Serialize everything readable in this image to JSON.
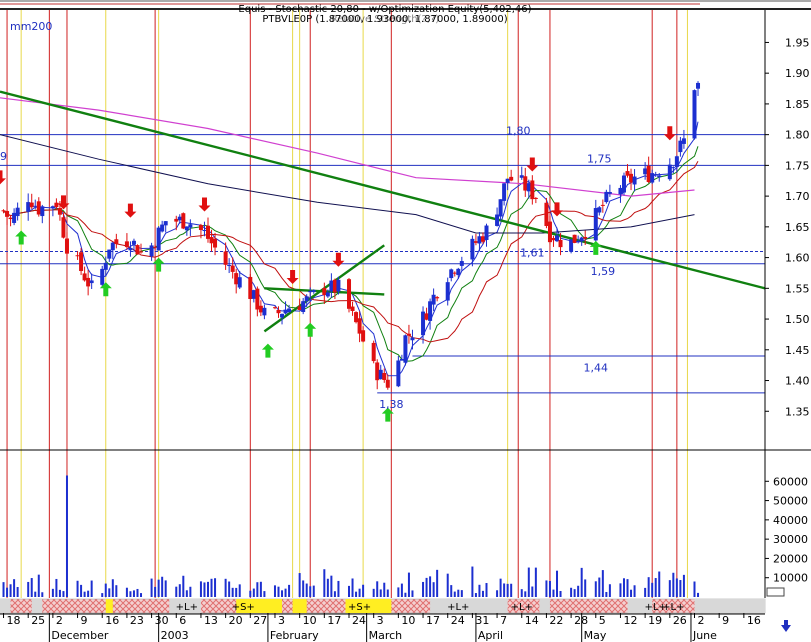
{
  "header": {
    "line1": "Equis - Stochastic 20,80 - w/Optimization Equity(5,402,46)",
    "line2": "PTBVLE0P (1.87000, 1.93000, 1.87000, 1.89000)",
    "overlay": "Relative Strength(?,?)"
  },
  "legend_mm": "mm200",
  "left_tag": "9",
  "price_labels": [
    {
      "text": "1,80",
      "price": 1.8,
      "date": "2003-04-13"
    },
    {
      "text": "1,75",
      "price": 1.755,
      "date": "2003-05-06"
    },
    {
      "text": "1,61",
      "price": 1.602,
      "date": "2003-04-17"
    },
    {
      "text": "1,59",
      "price": 1.572,
      "date": "2003-05-07"
    },
    {
      "text": "1,44",
      "price": 1.415,
      "date": "2003-05-05"
    },
    {
      "text": "1,38",
      "price": 1.355,
      "date": "2003-03-08"
    }
  ],
  "bar_labels": [
    {
      "text": "+L+",
      "date": "2003-01-09"
    },
    {
      "text": "+S+",
      "date": "2003-01-25"
    },
    {
      "text": "+S+",
      "date": "2003-02-27"
    },
    {
      "text": "+L+",
      "date": "2003-03-27"
    },
    {
      "text": "+L+",
      "date": "2003-04-14"
    },
    {
      "text": "+L+",
      "date": "2003-05-22"
    },
    {
      "text": "+L+",
      "date": "2003-05-27"
    }
  ],
  "chart_data": {
    "type": "candlestick",
    "title": "",
    "x_range": [
      "2002-11-17",
      "2003-06-22"
    ],
    "price_axis": {
      "range": [
        1.3,
        1.98
      ],
      "ticks": [
        1.35,
        1.4,
        1.45,
        1.5,
        1.55,
        1.6,
        1.65,
        1.7,
        1.75,
        1.8,
        1.85,
        1.9,
        1.95
      ]
    },
    "volume_axis": {
      "range": [
        0,
        70000
      ],
      "ticks": [
        10000,
        20000,
        30000,
        40000,
        50000,
        60000
      ]
    },
    "x_day_ticks": [
      "18",
      "25",
      "2",
      "9",
      "16",
      "23",
      "30",
      "6",
      "13",
      "20",
      "27",
      "3",
      "10",
      "17",
      "24",
      "3",
      "10",
      "17",
      "24",
      "31",
      "7",
      "14",
      "22",
      "28",
      "5",
      "12",
      "19",
      "26",
      "2",
      "9",
      "16"
    ],
    "x_month_labels": [
      {
        "text": "December",
        "date": "2002-12-01"
      },
      {
        "text": "2003",
        "date": "2003-01-01"
      },
      {
        "text": "February",
        "date": "2003-02-01"
      },
      {
        "text": "March",
        "date": "2003-03-01"
      },
      {
        "text": "April",
        "date": "2003-04-01"
      },
      {
        "text": "May",
        "date": "2003-05-01"
      },
      {
        "text": "June",
        "date": "2003-06-01"
      }
    ],
    "price_anchors": [
      [
        "2002-11-15",
        1.7
      ],
      [
        "2002-11-20",
        1.66
      ],
      [
        "2002-11-25",
        1.7
      ],
      [
        "2002-11-28",
        1.68
      ],
      [
        "2002-12-03",
        1.69
      ],
      [
        "2002-12-06",
        1.62
      ],
      [
        "2002-12-11",
        1.57
      ],
      [
        "2002-12-14",
        1.54
      ],
      [
        "2002-12-18",
        1.62
      ],
      [
        "2002-12-24",
        1.63
      ],
      [
        "2002-12-28",
        1.6
      ],
      [
        "2003-01-03",
        1.66
      ],
      [
        "2003-01-09",
        1.66
      ],
      [
        "2003-01-14",
        1.64
      ],
      [
        "2003-01-20",
        1.59
      ],
      [
        "2003-01-26",
        1.55
      ],
      [
        "2003-02-01",
        1.5
      ],
      [
        "2003-02-07",
        1.52
      ],
      [
        "2003-02-12",
        1.53
      ],
      [
        "2003-02-17",
        1.55
      ],
      [
        "2003-02-21",
        1.55
      ],
      [
        "2003-02-27",
        1.48
      ],
      [
        "2003-03-03",
        1.42
      ],
      [
        "2003-03-08",
        1.39
      ],
      [
        "2003-03-12",
        1.47
      ],
      [
        "2003-03-16",
        1.49
      ],
      [
        "2003-03-22",
        1.56
      ],
      [
        "2003-03-28",
        1.6
      ],
      [
        "2003-04-05",
        1.65
      ],
      [
        "2003-04-10",
        1.73
      ],
      [
        "2003-04-14",
        1.72
      ],
      [
        "2003-04-18",
        1.7
      ],
      [
        "2003-04-22",
        1.64
      ],
      [
        "2003-04-27",
        1.62
      ],
      [
        "2003-05-03",
        1.65
      ],
      [
        "2003-05-10",
        1.71
      ],
      [
        "2003-05-16",
        1.73
      ],
      [
        "2003-05-22",
        1.74
      ],
      [
        "2003-05-27",
        1.76
      ],
      [
        "2003-05-30",
        1.79
      ],
      [
        "2003-06-02",
        1.88
      ]
    ],
    "indicators": {
      "mm200": [
        [
          "2002-11-17",
          1.86
        ],
        [
          "2002-12-15",
          1.84
        ],
        [
          "2003-01-15",
          1.81
        ],
        [
          "2003-02-15",
          1.77
        ],
        [
          "2003-03-15",
          1.73
        ],
        [
          "2003-04-15",
          1.72
        ],
        [
          "2003-05-15",
          1.7
        ],
        [
          "2003-06-02",
          1.71
        ]
      ],
      "long_ma": [
        [
          "2002-11-17",
          1.8
        ],
        [
          "2002-12-15",
          1.76
        ],
        [
          "2003-01-15",
          1.72
        ],
        [
          "2003-02-15",
          1.69
        ],
        [
          "2003-03-15",
          1.67
        ],
        [
          "2003-04-01",
          1.64
        ],
        [
          "2003-04-20",
          1.64
        ],
        [
          "2003-05-15",
          1.65
        ],
        [
          "2003-06-02",
          1.67
        ]
      ]
    },
    "trendlines": [
      {
        "from": [
          "2002-11-17",
          1.87
        ],
        "to": [
          "2003-06-22",
          1.55
        ],
        "color": "#108010"
      },
      {
        "from": [
          "2003-01-31",
          1.48
        ],
        "to": [
          "2003-03-06",
          1.62
        ],
        "color": "#108010"
      },
      {
        "from": [
          "2003-01-31",
          1.55
        ],
        "to": [
          "2003-03-06",
          1.54
        ],
        "color": "#108010"
      }
    ],
    "horizontal_levels": [
      1.8,
      1.75,
      1.59,
      1.44,
      1.38,
      1.61
    ],
    "buy_signals": [
      "2002-11-23",
      "2002-12-17",
      "2003-01-01",
      "2003-02-01",
      "2003-02-13",
      "2003-03-07",
      "2003-05-05"
    ],
    "sell_signals": [
      "2002-11-17",
      "2002-12-05",
      "2002-12-24",
      "2003-01-14",
      "2003-02-08",
      "2003-02-21",
      "2003-04-17",
      "2003-04-24",
      "2003-05-26"
    ],
    "vertical_red": [
      "2002-11-19",
      "2002-12-01",
      "2002-12-06",
      "2002-12-31",
      "2003-01-27",
      "2003-02-13",
      "2003-03-08",
      "2003-04-13",
      "2003-04-22",
      "2003-05-21",
      "2003-05-28"
    ],
    "vertical_yellow": [
      "2002-11-23",
      "2002-12-17",
      "2003-01-01",
      "2003-02-08",
      "2003-02-10",
      "2003-02-28",
      "2003-04-10",
      "2003-05-31"
    ],
    "volume_spike": {
      "date": "2002-12-06",
      "value": 63000
    }
  }
}
